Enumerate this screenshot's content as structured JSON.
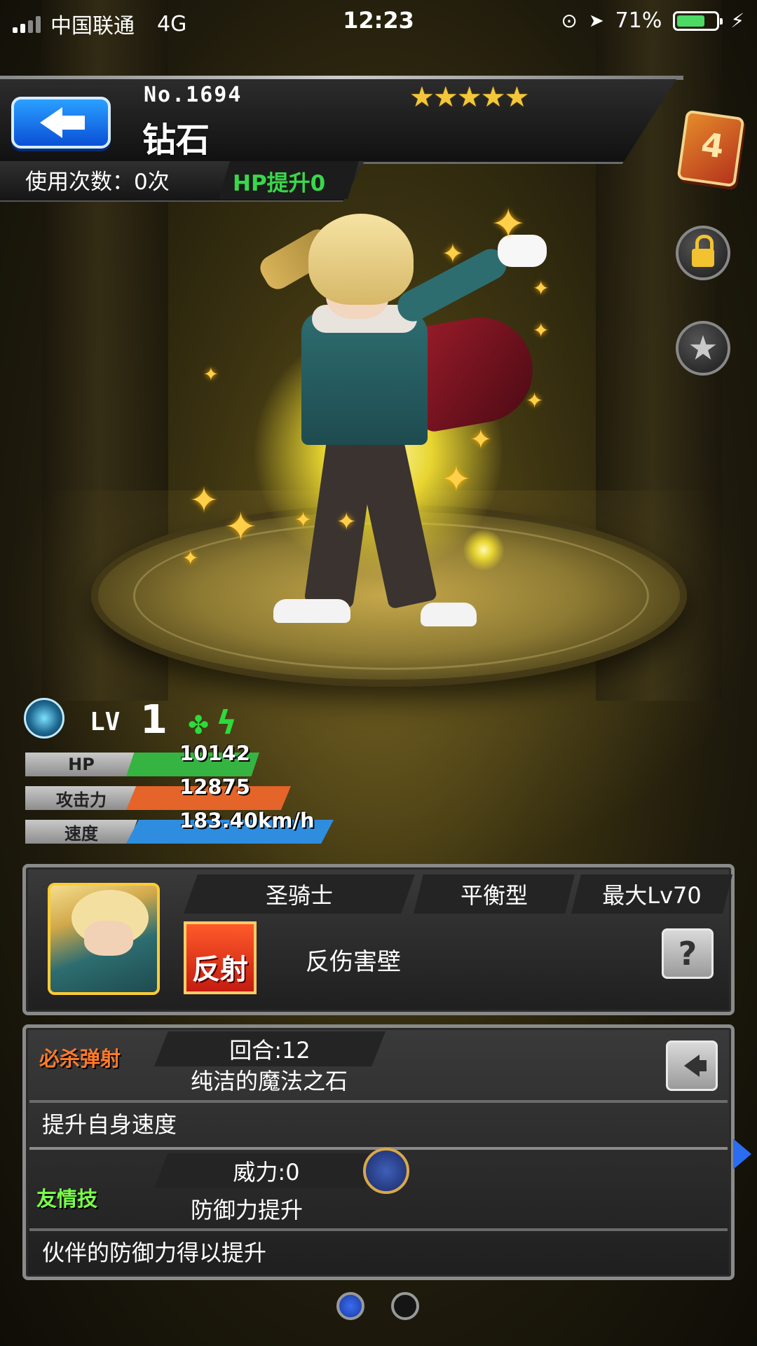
{
  "statusbar": {
    "carrier": "中国联通",
    "network": "4G",
    "time": "12:23",
    "battery_pct": "71%",
    "battery_level": 0.71,
    "battery_color": "#4cd964"
  },
  "header": {
    "number": "No.1694",
    "name": "钻石",
    "rarity_stars": "★★★★★",
    "usage": "使用次数：0次",
    "hp_up": "HP提升0",
    "back_icon": "back-arrow-icon",
    "book_icon": "book-icon",
    "lock_icon": "lock-icon",
    "star_icon": "star-icon"
  },
  "stats": {
    "level_label": "LV",
    "level": "1",
    "rows": [
      {
        "label": "HP",
        "value": "10142",
        "color": "#35b441"
      },
      {
        "label": "攻击力",
        "value": "12875",
        "color": "#e4642a"
      },
      {
        "label": "速度",
        "value": "183.40km/h",
        "color": "#2f8de0"
      }
    ]
  },
  "info": {
    "race": "圣骑士",
    "type": "平衡型",
    "max_level": "最大Lv70",
    "ability_icon_label": "反射",
    "ability": "反伤害壁",
    "help_label": "?"
  },
  "skills": {
    "strike": {
      "title": "必杀弹射",
      "turns": "回合:12",
      "name": "纯洁的魔法之石",
      "desc": "提升自身速度"
    },
    "friendship": {
      "title": "友情技",
      "power": "威力:0",
      "name": "防御力提升",
      "desc": "伙伴的防御力得以提升"
    }
  },
  "pager": {
    "pages": 2,
    "active": 1,
    "active_color": "#3a6df0"
  }
}
